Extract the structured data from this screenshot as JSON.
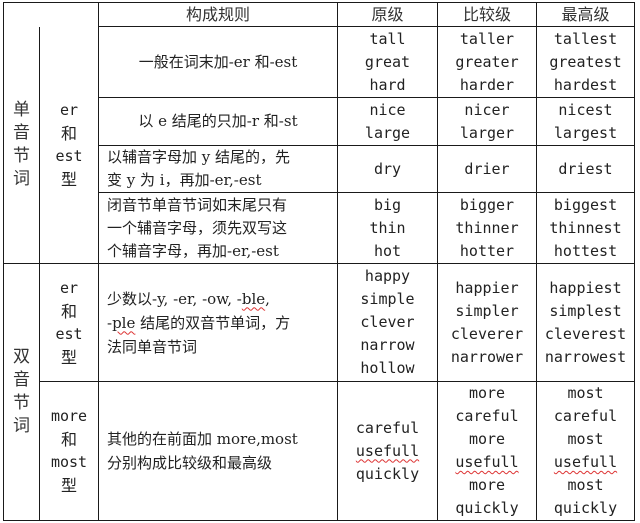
{
  "header": {
    "rule": "构成规则",
    "positive": "原级",
    "comparative": "比较级",
    "superlative": "最高级"
  },
  "groups": [
    {
      "name_chars": [
        "单",
        "音",
        "节",
        "词"
      ],
      "types": [
        {
          "type_lines": [
            "er",
            "和",
            "est",
            "型"
          ],
          "rows": [
            {
              "rule_lines": [
                "一般在词末加-er 和-est"
              ],
              "positive": [
                "tall",
                "great",
                "hard"
              ],
              "comparative": [
                "taller",
                "greater",
                "harder"
              ],
              "superlative": [
                "tallest",
                "greatest",
                "hardest"
              ]
            },
            {
              "rule_lines": [
                "以 e 结尾的只加-r 和-st"
              ],
              "positive": [
                "nice",
                "large"
              ],
              "comparative": [
                "nicer",
                "larger"
              ],
              "superlative": [
                "nicest",
                "largest"
              ]
            },
            {
              "rule_lines": [
                "以辅音字母加 y 结尾的，先",
                "变 y 为 i，再加-er,-est"
              ],
              "positive": [
                "dry"
              ],
              "comparative": [
                "drier"
              ],
              "superlative": [
                "driest"
              ]
            },
            {
              "rule_lines": [
                "闭音节单音节词如末尾只有",
                "一个辅音字母，须先双写这",
                "个辅音字母，再加-er,-est"
              ],
              "positive": [
                "big",
                "thin",
                "hot"
              ],
              "comparative": [
                "bigger",
                "thinner",
                "hotter"
              ],
              "superlative": [
                "biggest",
                "thinnest",
                "hottest"
              ]
            }
          ]
        }
      ]
    },
    {
      "name_chars": [
        "双",
        "音",
        "节",
        "词"
      ],
      "types": [
        {
          "type_lines": [
            "er",
            "和",
            "est",
            "型"
          ],
          "rows": [
            {
              "rule_lines": [
                "少数以-y, -er, -ow, -ble,",
                "-ple 结尾的双音节单词，方",
                "法同单音节词"
              ],
              "positive": [
                "happy",
                "simple",
                "clever",
                "narrow",
                "hollow"
              ],
              "comparative": [
                "happier",
                "simpler",
                "cleverer",
                "narrower"
              ],
              "superlative": [
                "happiest",
                "simplest",
                "cleverest",
                "narrowest"
              ]
            }
          ]
        },
        {
          "type_lines": [
            "more",
            "和",
            "most",
            "型"
          ],
          "rows": [
            {
              "rule_lines": [
                "其他的在前面加 more,most",
                "分别构成比较级和最高级"
              ],
              "positive": [
                "careful",
                "usefull",
                "quickly"
              ],
              "comparative": [
                "more",
                "careful",
                "more",
                "usefull",
                "more",
                "quickly"
              ],
              "superlative": [
                "most",
                "careful",
                "most",
                "usefull",
                "most",
                "quickly"
              ]
            }
          ]
        }
      ]
    }
  ]
}
